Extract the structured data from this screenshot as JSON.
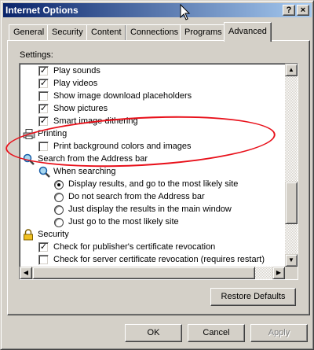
{
  "window": {
    "title": "Internet Options",
    "help_button": "?",
    "close_button": "×"
  },
  "tabs": [
    {
      "label": "General"
    },
    {
      "label": "Security"
    },
    {
      "label": "Content"
    },
    {
      "label": "Connections"
    },
    {
      "label": "Programs"
    },
    {
      "label": "Advanced",
      "active": true
    }
  ],
  "settings": {
    "label": "Settings:",
    "items": [
      {
        "kind": "checkbox",
        "checked": true,
        "label": "Play sounds"
      },
      {
        "kind": "checkbox",
        "checked": true,
        "label": "Play videos"
      },
      {
        "kind": "checkbox",
        "checked": false,
        "label": "Show image download placeholders"
      },
      {
        "kind": "checkbox",
        "checked": true,
        "label": "Show pictures"
      },
      {
        "kind": "checkbox",
        "checked": true,
        "label": "Smart image dithering"
      },
      {
        "kind": "category",
        "icon": "printer-icon",
        "label": "Printing"
      },
      {
        "kind": "checkbox",
        "checked": false,
        "label": "Print background colors and images"
      },
      {
        "kind": "category",
        "icon": "search-icon",
        "label": "Search from the Address bar"
      },
      {
        "kind": "subcategory",
        "icon": "search-icon",
        "label": "When searching"
      },
      {
        "kind": "radio",
        "selected": true,
        "label": "Display results, and go to the most likely site"
      },
      {
        "kind": "radio",
        "selected": false,
        "label": "Do not search from the Address bar"
      },
      {
        "kind": "radio",
        "selected": false,
        "label": "Just display the results in the main window"
      },
      {
        "kind": "radio",
        "selected": false,
        "label": "Just go to the most likely site"
      },
      {
        "kind": "category",
        "icon": "lock-icon",
        "label": "Security"
      },
      {
        "kind": "checkbox",
        "checked": true,
        "label": "Check for publisher's certificate revocation"
      },
      {
        "kind": "checkbox",
        "checked": false,
        "label": "Check for server certificate revocation (requires restart)"
      }
    ]
  },
  "buttons": {
    "restore_defaults": "Restore Defaults",
    "ok": "OK",
    "cancel": "Cancel",
    "apply": "Apply"
  },
  "colors": {
    "annotation": "#e8101a",
    "titlebar_start": "#0a246a",
    "titlebar_end": "#a6caf0"
  }
}
